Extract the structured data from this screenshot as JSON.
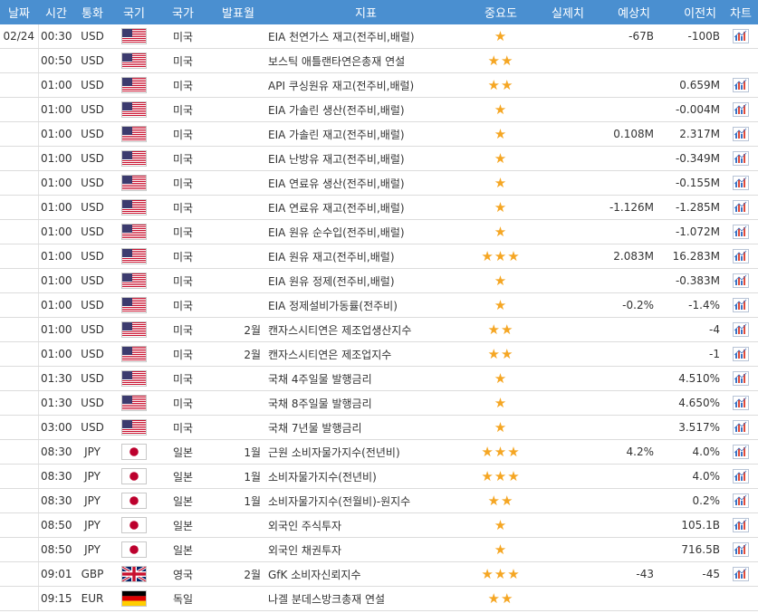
{
  "headers": {
    "date": "날짜",
    "time": "시간",
    "currency": "통화",
    "flag": "국기",
    "country": "국가",
    "period": "발표월",
    "event": "지표",
    "importance": "중요도",
    "actual": "실제치",
    "forecast": "예상치",
    "previous": "이전치",
    "chart": "차트"
  },
  "flag_colors": {
    "us": {
      "red": "#c8102e",
      "white": "#ffffff",
      "blue": "#3c3b6e"
    },
    "jp": {
      "white": "#ffffff",
      "red": "#bc002d"
    },
    "gb": {
      "blue": "#012169",
      "white": "#ffffff",
      "red": "#c8102e"
    },
    "de": {
      "black": "#000000",
      "red": "#dd0000",
      "gold": "#ffce00"
    }
  },
  "star_color": "#f5a623",
  "header_color": "#4a8fd0",
  "rows": [
    {
      "date": "02/24",
      "time": "00:30",
      "currency": "USD",
      "flag": "us",
      "country": "미국",
      "period": "",
      "event": "EIA 천연가스 재고(전주비,배럴)",
      "stars": 1,
      "stars_text": "★",
      "actual": "",
      "forecast": "-67B",
      "previous": "-100B",
      "chart_icon": "chart-icon"
    },
    {
      "date": "",
      "time": "00:50",
      "currency": "USD",
      "flag": "us",
      "country": "미국",
      "period": "",
      "event": "보스틱 애틀랜타연은총재 연설",
      "stars": 2,
      "stars_text": "★★",
      "actual": "",
      "forecast": "",
      "previous": "",
      "chart_icon": ""
    },
    {
      "date": "",
      "time": "01:00",
      "currency": "USD",
      "flag": "us",
      "country": "미국",
      "period": "",
      "event": "API 쿠싱원유 재고(전주비,배럴)",
      "stars": 2,
      "stars_text": "★★",
      "actual": "",
      "forecast": "",
      "previous": "0.659M",
      "chart_icon": "chart-icon"
    },
    {
      "date": "",
      "time": "01:00",
      "currency": "USD",
      "flag": "us",
      "country": "미국",
      "period": "",
      "event": "EIA 가솔린 생산(전주비,배럴)",
      "stars": 1,
      "stars_text": "★",
      "actual": "",
      "forecast": "",
      "previous": "-0.004M",
      "chart_icon": "chart-icon"
    },
    {
      "date": "",
      "time": "01:00",
      "currency": "USD",
      "flag": "us",
      "country": "미국",
      "period": "",
      "event": "EIA 가솔린 재고(전주비,배럴)",
      "stars": 1,
      "stars_text": "★",
      "actual": "",
      "forecast": "0.108M",
      "previous": "2.317M",
      "chart_icon": "chart-icon"
    },
    {
      "date": "",
      "time": "01:00",
      "currency": "USD",
      "flag": "us",
      "country": "미국",
      "period": "",
      "event": "EIA 난방유 재고(전주비,배럴)",
      "stars": 1,
      "stars_text": "★",
      "actual": "",
      "forecast": "",
      "previous": "-0.349M",
      "chart_icon": "chart-icon"
    },
    {
      "date": "",
      "time": "01:00",
      "currency": "USD",
      "flag": "us",
      "country": "미국",
      "period": "",
      "event": "EIA 연료유 생산(전주비,배럴)",
      "stars": 1,
      "stars_text": "★",
      "actual": "",
      "forecast": "",
      "previous": "-0.155M",
      "chart_icon": "chart-icon"
    },
    {
      "date": "",
      "time": "01:00",
      "currency": "USD",
      "flag": "us",
      "country": "미국",
      "period": "",
      "event": "EIA 연료유 재고(전주비,배럴)",
      "stars": 1,
      "stars_text": "★",
      "actual": "",
      "forecast": "-1.126M",
      "previous": "-1.285M",
      "chart_icon": "chart-icon"
    },
    {
      "date": "",
      "time": "01:00",
      "currency": "USD",
      "flag": "us",
      "country": "미국",
      "period": "",
      "event": "EIA 원유 순수입(전주비,배럴)",
      "stars": 1,
      "stars_text": "★",
      "actual": "",
      "forecast": "",
      "previous": "-1.072M",
      "chart_icon": "chart-icon"
    },
    {
      "date": "",
      "time": "01:00",
      "currency": "USD",
      "flag": "us",
      "country": "미국",
      "period": "",
      "event": "EIA 원유 재고(전주비,배럴)",
      "stars": 3,
      "stars_text": "★★★",
      "actual": "",
      "forecast": "2.083M",
      "previous": "16.283M",
      "chart_icon": "chart-icon"
    },
    {
      "date": "",
      "time": "01:00",
      "currency": "USD",
      "flag": "us",
      "country": "미국",
      "period": "",
      "event": "EIA 원유 정제(전주비,배럴)",
      "stars": 1,
      "stars_text": "★",
      "actual": "",
      "forecast": "",
      "previous": "-0.383M",
      "chart_icon": "chart-icon"
    },
    {
      "date": "",
      "time": "01:00",
      "currency": "USD",
      "flag": "us",
      "country": "미국",
      "period": "",
      "event": "EIA 정제설비가동률(전주비)",
      "stars": 1,
      "stars_text": "★",
      "actual": "",
      "forecast": "-0.2%",
      "previous": "-1.4%",
      "chart_icon": "chart-icon"
    },
    {
      "date": "",
      "time": "01:00",
      "currency": "USD",
      "flag": "us",
      "country": "미국",
      "period": "2월",
      "event": "캔자스시티연은 제조업생산지수",
      "stars": 2,
      "stars_text": "★★",
      "actual": "",
      "forecast": "",
      "previous": "-4",
      "chart_icon": "chart-icon"
    },
    {
      "date": "",
      "time": "01:00",
      "currency": "USD",
      "flag": "us",
      "country": "미국",
      "period": "2월",
      "event": "캔자스시티연은 제조업지수",
      "stars": 2,
      "stars_text": "★★",
      "actual": "",
      "forecast": "",
      "previous": "-1",
      "chart_icon": "chart-icon"
    },
    {
      "date": "",
      "time": "01:30",
      "currency": "USD",
      "flag": "us",
      "country": "미국",
      "period": "",
      "event": "국채 4주일물 발행금리",
      "stars": 1,
      "stars_text": "★",
      "actual": "",
      "forecast": "",
      "previous": "4.510%",
      "chart_icon": "chart-icon"
    },
    {
      "date": "",
      "time": "01:30",
      "currency": "USD",
      "flag": "us",
      "country": "미국",
      "period": "",
      "event": "국채 8주일물 발행금리",
      "stars": 1,
      "stars_text": "★",
      "actual": "",
      "forecast": "",
      "previous": "4.650%",
      "chart_icon": "chart-icon"
    },
    {
      "date": "",
      "time": "03:00",
      "currency": "USD",
      "flag": "us",
      "country": "미국",
      "period": "",
      "event": "국채 7년물 발행금리",
      "stars": 1,
      "stars_text": "★",
      "actual": "",
      "forecast": "",
      "previous": "3.517%",
      "chart_icon": "chart-icon"
    },
    {
      "date": "",
      "time": "08:30",
      "currency": "JPY",
      "flag": "jp",
      "country": "일본",
      "period": "1월",
      "event": "근원 소비자물가지수(전년비)",
      "stars": 3,
      "stars_text": "★★★",
      "actual": "",
      "forecast": "4.2%",
      "previous": "4.0%",
      "chart_icon": "chart-icon"
    },
    {
      "date": "",
      "time": "08:30",
      "currency": "JPY",
      "flag": "jp",
      "country": "일본",
      "period": "1월",
      "event": "소비자물가지수(전년비)",
      "stars": 3,
      "stars_text": "★★★",
      "actual": "",
      "forecast": "",
      "previous": "4.0%",
      "chart_icon": "chart-icon"
    },
    {
      "date": "",
      "time": "08:30",
      "currency": "JPY",
      "flag": "jp",
      "country": "일본",
      "period": "1월",
      "event": "소비자물가지수(전월비)-원지수",
      "stars": 2,
      "stars_text": "★★",
      "actual": "",
      "forecast": "",
      "previous": "0.2%",
      "chart_icon": "chart-icon"
    },
    {
      "date": "",
      "time": "08:50",
      "currency": "JPY",
      "flag": "jp",
      "country": "일본",
      "period": "",
      "event": "외국인 주식투자",
      "stars": 1,
      "stars_text": "★",
      "actual": "",
      "forecast": "",
      "previous": "105.1B",
      "chart_icon": "chart-icon"
    },
    {
      "date": "",
      "time": "08:50",
      "currency": "JPY",
      "flag": "jp",
      "country": "일본",
      "period": "",
      "event": "외국인 채권투자",
      "stars": 1,
      "stars_text": "★",
      "actual": "",
      "forecast": "",
      "previous": "716.5B",
      "chart_icon": "chart-icon"
    },
    {
      "date": "",
      "time": "09:01",
      "currency": "GBP",
      "flag": "gb",
      "country": "영국",
      "period": "2월",
      "event": "GfK 소비자신뢰지수",
      "stars": 3,
      "stars_text": "★★★",
      "actual": "",
      "forecast": "-43",
      "previous": "-45",
      "chart_icon": "chart-icon"
    },
    {
      "date": "",
      "time": "09:15",
      "currency": "EUR",
      "flag": "de",
      "country": "독일",
      "period": "",
      "event": "나겔 분데스방크총재 연설",
      "stars": 2,
      "stars_text": "★★",
      "actual": "",
      "forecast": "",
      "previous": "",
      "chart_icon": ""
    }
  ]
}
